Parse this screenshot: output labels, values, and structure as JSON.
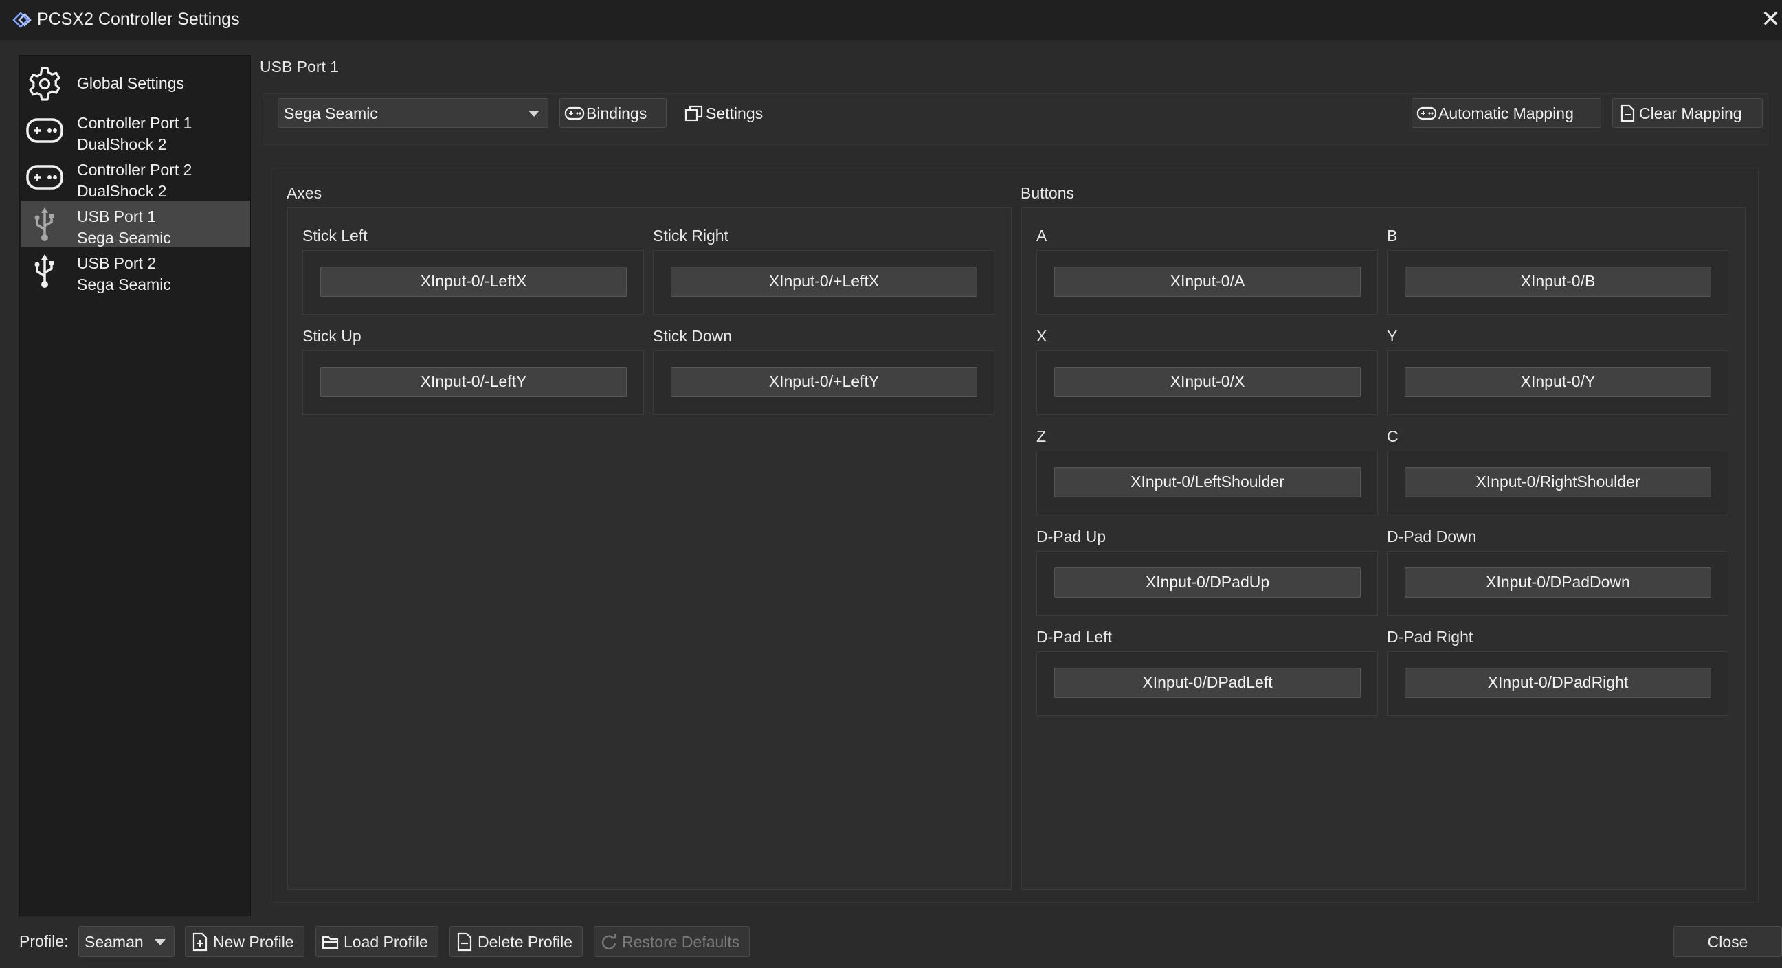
{
  "window": {
    "title": "PCSX2 Controller Settings"
  },
  "sidebar": {
    "items": [
      {
        "line1": "Global Settings",
        "line2": "",
        "icon": "gear-icon"
      },
      {
        "line1": "Controller Port 1",
        "line2": "DualShock 2",
        "icon": "gamepad-icon"
      },
      {
        "line1": "Controller Port 2",
        "line2": "DualShock 2",
        "icon": "gamepad-icon"
      },
      {
        "line1": "USB Port 1",
        "line2": "Sega Seamic",
        "icon": "usb-icon",
        "active": true
      },
      {
        "line1": "USB Port 2",
        "line2": "Sega Seamic",
        "icon": "usb-icon"
      }
    ]
  },
  "header": {
    "port_title": "USB Port 1"
  },
  "toolbar": {
    "device_select": "Sega Seamic",
    "bindings": "Bindings",
    "settings": "Settings",
    "automatic_mapping": "Automatic Mapping",
    "clear_mapping": "Clear Mapping"
  },
  "axes": {
    "title": "Axes",
    "items": [
      {
        "label": "Stick Left",
        "binding": "XInput-0/-LeftX"
      },
      {
        "label": "Stick Right",
        "binding": "XInput-0/+LeftX"
      },
      {
        "label": "Stick Up",
        "binding": "XInput-0/-LeftY"
      },
      {
        "label": "Stick Down",
        "binding": "XInput-0/+LeftY"
      }
    ]
  },
  "buttons": {
    "title": "Buttons",
    "items": [
      {
        "label": "A",
        "binding": "XInput-0/A"
      },
      {
        "label": "B",
        "binding": "XInput-0/B"
      },
      {
        "label": "X",
        "binding": "XInput-0/X"
      },
      {
        "label": "Y",
        "binding": "XInput-0/Y"
      },
      {
        "label": "Z",
        "binding": "XInput-0/LeftShoulder"
      },
      {
        "label": "C",
        "binding": "XInput-0/RightShoulder"
      },
      {
        "label": "D-Pad Up",
        "binding": "XInput-0/DPadUp"
      },
      {
        "label": "D-Pad Down",
        "binding": "XInput-0/DPadDown"
      },
      {
        "label": "D-Pad Left",
        "binding": "XInput-0/DPadLeft"
      },
      {
        "label": "D-Pad Right",
        "binding": "XInput-0/DPadRight"
      }
    ]
  },
  "footer": {
    "profile_label": "Profile:",
    "profile_value": "Seaman",
    "new_profile": "New Profile",
    "load_profile": "Load Profile",
    "delete_profile": "Delete Profile",
    "restore_defaults": "Restore Defaults",
    "close": "Close"
  }
}
